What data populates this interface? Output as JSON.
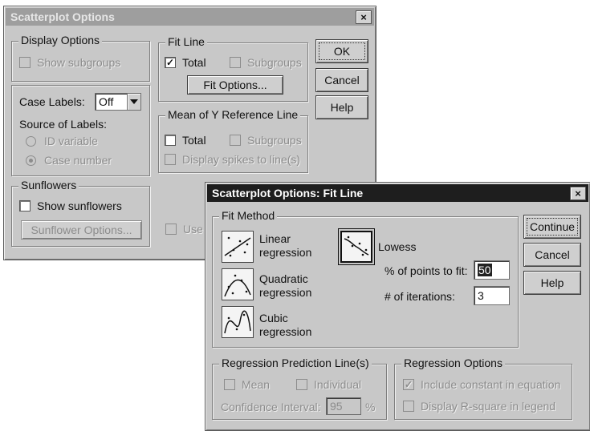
{
  "main_dialog": {
    "title": "Scatterplot Options",
    "close_glyph": "×",
    "display_options": {
      "legend": "Display Options",
      "show_subgroups": "Show subgroups",
      "case_labels_label": "Case Labels:",
      "case_labels_value": "Off",
      "source_of_labels": "Source of Labels:",
      "id_variable": "ID variable",
      "case_number": "Case number"
    },
    "sunflowers": {
      "legend": "Sunflowers",
      "show_sunflowers": "Show sunflowers",
      "options_button": "Sunflower Options..."
    },
    "fit_line": {
      "legend": "Fit Line",
      "total": "Total",
      "total_checked": true,
      "subgroups": "Subgroups",
      "fit_options_button": "Fit Options..."
    },
    "mean_y": {
      "legend": "Mean of Y Reference Line",
      "total": "Total",
      "subgroups": "Subgroups",
      "display_spikes": "Display spikes to line(s)"
    },
    "use_partial": "Use",
    "buttons": {
      "ok": "OK",
      "cancel": "Cancel",
      "help": "Help"
    }
  },
  "fit_dialog": {
    "title": "Scatterplot Options: Fit Line",
    "close_glyph": "×",
    "fit_method": {
      "legend": "Fit Method",
      "linear": [
        "Linear",
        "regression"
      ],
      "quadratic": [
        "Quadratic",
        "regression"
      ],
      "cubic": [
        "Cubic",
        "regression"
      ],
      "lowess": "Lowess",
      "points_label": "% of points to fit:",
      "points_value": "50",
      "iterations_label": "# of iterations:",
      "iterations_value": "3"
    },
    "prediction": {
      "legend": "Regression Prediction Line(s)",
      "mean": "Mean",
      "individual": "Individual",
      "ci_label": "Confidence Interval:",
      "ci_value": "95",
      "ci_unit": "%"
    },
    "regression_options": {
      "legend": "Regression Options",
      "include_constant": "Include constant in equation",
      "include_constant_checked": true,
      "display_rsquare": "Display R-square in legend"
    },
    "buttons": {
      "continue": "Continue",
      "cancel": "Cancel",
      "help": "Help"
    }
  },
  "colors": {
    "dialog_face": "#c8c8c8",
    "active_title": "#1e1e1e",
    "inactive_title": "#9e9e9e",
    "disabled_text": "#8c8c8c"
  }
}
